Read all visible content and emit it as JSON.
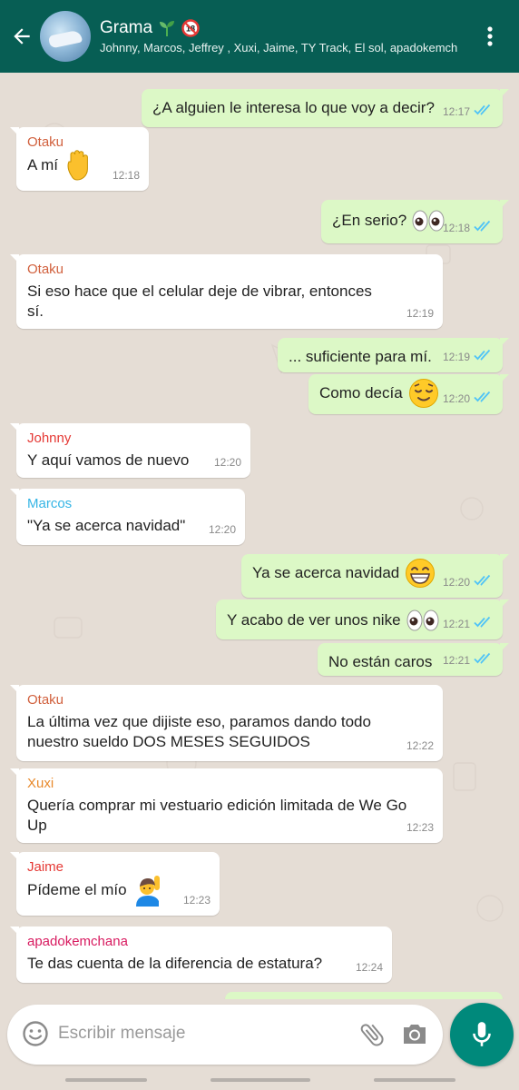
{
  "header": {
    "group_name": "Grama",
    "members": "Johnny, Marcos, Jeffrey , Xuxi, Jaime, TY Track, El sol, apadokemch"
  },
  "messages": [
    {
      "dir": "out",
      "text": "¿A alguien le interesa lo que voy a decir?",
      "time": "12:17"
    },
    {
      "dir": "in",
      "sender": "Otaku",
      "sender_color": "#d1603d",
      "text": "A mí",
      "emoji": "raised-hand",
      "time": "12:18"
    },
    {
      "dir": "out",
      "text": "¿En serio?",
      "emoji": "eyes",
      "time": "12:18"
    },
    {
      "dir": "in",
      "sender": "Otaku",
      "sender_color": "#d1603d",
      "text_lines": [
        "Si eso hace que el celular deje de vibrar, entonces",
        "sí."
      ],
      "time": "12:19"
    },
    {
      "dir": "out",
      "text": "... suficiente para mí.",
      "time": "12:19"
    },
    {
      "dir": "out",
      "text": "Como decía",
      "emoji": "relieved-face",
      "time": "12:20"
    },
    {
      "dir": "in",
      "sender": "Johnny",
      "sender_color": "#e53935",
      "text": "Y aquí vamos de nuevo",
      "time": "12:20"
    },
    {
      "dir": "in",
      "sender": "Marcos",
      "sender_color": "#35b5e5",
      "text": "\"Ya se acerca navidad\"",
      "time": "12:20"
    },
    {
      "dir": "out",
      "text": "Ya se acerca navidad",
      "emoji": "grinning-face",
      "time": "12:20"
    },
    {
      "dir": "out",
      "text": "Y acabo de ver unos nike",
      "emoji": "eyes",
      "time": "12:21"
    },
    {
      "dir": "out",
      "text": "No están caros",
      "time": "12:21"
    },
    {
      "dir": "in",
      "sender": "Otaku",
      "sender_color": "#d1603d",
      "text_lines": [
        "La última vez que dijiste eso, paramos dando todo",
        "nuestro sueldo DOS MESES SEGUIDOS"
      ],
      "time": "12:22"
    },
    {
      "dir": "in",
      "sender": "Xuxi",
      "sender_color": "#e8892b",
      "text_lines": [
        "Quería comprar mi vestuario edición limitada de We Go",
        "Up"
      ],
      "time": "12:23"
    },
    {
      "dir": "in",
      "sender": "Jaime",
      "sender_color": "#e53935",
      "text": "Pídeme el mío",
      "emoji": "person-raising-hand",
      "time": "12:23"
    },
    {
      "dir": "in",
      "sender": "apadokemchana",
      "sender_color": "#d81b60",
      "text": "Te das cuenta de la diferencia de estatura?",
      "time": "12:24"
    }
  ],
  "composer": {
    "placeholder": "Escribir mensaje"
  },
  "colors": {
    "header": "#075e54",
    "outgoing_bubble": "#dcf8c6",
    "incoming_bubble": "#ffffff",
    "chat_background": "#e5ddd5",
    "read_ticks": "#4fc3f7",
    "mic_button": "#00897b"
  }
}
